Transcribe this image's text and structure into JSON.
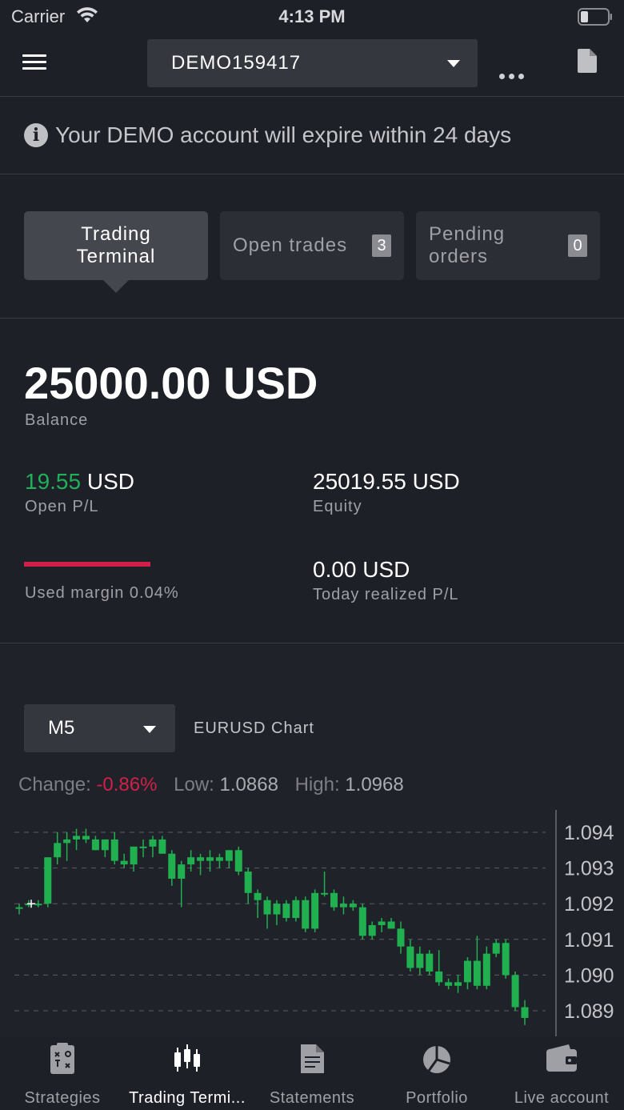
{
  "status_bar": {
    "carrier": "Carrier",
    "time": "4:13 PM"
  },
  "header": {
    "account": "DEMO159417",
    "more_icon": "ellipsis-icon",
    "doc_icon": "document-icon"
  },
  "notice": {
    "icon": "info-icon",
    "text": "Your DEMO account will expire within 24 days"
  },
  "tabs": [
    {
      "label": "Trading Terminal",
      "badge": null,
      "active": true
    },
    {
      "label": "Open trades",
      "badge": "3",
      "active": false
    },
    {
      "label": "Pending orders",
      "badge": "0",
      "active": false
    }
  ],
  "summary": {
    "balance": "25000.00 USD",
    "balance_label": "Balance",
    "open_pl_value": "19.55",
    "open_pl_unit": "USD",
    "open_pl_label": "Open P/L",
    "equity_value": "25019.55 USD",
    "equity_label": "Equity",
    "used_margin_label": "Used margin 0.04%",
    "used_margin_pct": 0.04,
    "today_value": "0.00 USD",
    "today_label": "Today realized P/L"
  },
  "chart_controls": {
    "timeframe": "M5",
    "title": "EURUSD Chart",
    "change_label": "Change:",
    "change_value": "-0.86%",
    "low_label": "Low:",
    "low_value": "1.0868",
    "high_label": "High:",
    "high_value": "1.0968"
  },
  "colors": {
    "up": "#20b050",
    "down": "#20b050",
    "negative": "#d0204a",
    "grid": "#5a5c62",
    "axis_text": "#c4c5c9"
  },
  "chart_data": {
    "type": "candlestick",
    "title": "EURUSD Chart",
    "y_ticks": [
      "1.094",
      "1.093",
      "1.092",
      "1.091",
      "1.090",
      "1.089"
    ],
    "ylim": [
      1.0883,
      1.0946
    ],
    "grid": true,
    "candles": [
      [
        1.0919,
        1.092,
        1.0917,
        1.0919
      ],
      [
        1.092,
        1.0921,
        1.0919,
        1.092
      ],
      [
        1.092,
        1.0921,
        1.0919,
        1.092
      ],
      [
        1.092,
        1.0933,
        1.0919,
        1.0933
      ],
      [
        1.0933,
        1.094,
        1.0931,
        1.0937
      ],
      [
        1.0937,
        1.094,
        1.0932,
        1.0938
      ],
      [
        1.0938,
        1.0941,
        1.0935,
        1.0939
      ],
      [
        1.0939,
        1.0941,
        1.0937,
        1.0938
      ],
      [
        1.0938,
        1.0939,
        1.0935,
        1.0935
      ],
      [
        1.0935,
        1.0938,
        1.0933,
        1.0938
      ],
      [
        1.0938,
        1.094,
        1.0931,
        1.0932
      ],
      [
        1.0932,
        1.0934,
        1.093,
        1.0931
      ],
      [
        1.0931,
        1.0936,
        1.0929,
        1.0936
      ],
      [
        1.0936,
        1.0938,
        1.0933,
        1.0936
      ],
      [
        1.0936,
        1.0939,
        1.0933,
        1.0938
      ],
      [
        1.0938,
        1.0939,
        1.0934,
        1.0934
      ],
      [
        1.0934,
        1.0935,
        1.0925,
        1.0927
      ],
      [
        1.0927,
        1.0932,
        1.0919,
        1.0931
      ],
      [
        1.0931,
        1.0935,
        1.0929,
        1.0933
      ],
      [
        1.0933,
        1.0934,
        1.0928,
        1.0932
      ],
      [
        1.0932,
        1.0935,
        1.0929,
        1.0933
      ],
      [
        1.0933,
        1.0934,
        1.093,
        1.0932
      ],
      [
        1.0932,
        1.0935,
        1.093,
        1.0935
      ],
      [
        1.0935,
        1.0936,
        1.0928,
        1.0929
      ],
      [
        1.0929,
        1.093,
        1.092,
        1.0923
      ],
      [
        1.0923,
        1.0924,
        1.0916,
        1.0921
      ],
      [
        1.0921,
        1.0922,
        1.0913,
        1.0917
      ],
      [
        1.0917,
        1.0921,
        1.0914,
        1.092
      ],
      [
        1.092,
        1.0921,
        1.0915,
        1.0916
      ],
      [
        1.0916,
        1.0922,
        1.0915,
        1.0921
      ],
      [
        1.0921,
        1.0922,
        1.0912,
        1.0913
      ],
      [
        1.0913,
        1.0924,
        1.0912,
        1.0923
      ],
      [
        1.0923,
        1.0929,
        1.0922,
        1.0923
      ],
      [
        1.0923,
        1.0924,
        1.0918,
        1.0919
      ],
      [
        1.0919,
        1.0922,
        1.0917,
        1.092
      ],
      [
        1.092,
        1.0921,
        1.0918,
        1.0919
      ],
      [
        1.0919,
        1.092,
        1.091,
        1.0911
      ],
      [
        1.0911,
        1.0915,
        1.091,
        1.0914
      ],
      [
        1.0914,
        1.0916,
        1.0912,
        1.0915
      ],
      [
        1.0915,
        1.0916,
        1.0913,
        1.0913
      ],
      [
        1.0913,
        1.0915,
        1.0906,
        1.0908
      ],
      [
        1.0908,
        1.091,
        1.0901,
        1.0902
      ],
      [
        1.0902,
        1.0908,
        1.09,
        1.0906
      ],
      [
        1.0906,
        1.0907,
        1.09,
        1.0901
      ],
      [
        1.0901,
        1.0907,
        1.0897,
        1.0898
      ],
      [
        1.0898,
        1.0899,
        1.0896,
        1.0897
      ],
      [
        1.0897,
        1.09,
        1.0895,
        1.0898
      ],
      [
        1.0898,
        1.0905,
        1.0896,
        1.0904
      ],
      [
        1.0904,
        1.0911,
        1.0896,
        1.0897
      ],
      [
        1.0897,
        1.0908,
        1.0896,
        1.0906
      ],
      [
        1.0906,
        1.091,
        1.0905,
        1.0909
      ],
      [
        1.0909,
        1.091,
        1.0899,
        1.09
      ],
      [
        1.09,
        1.0901,
        1.089,
        1.0891
      ],
      [
        1.0891,
        1.0893,
        1.0886,
        1.0888
      ]
    ]
  },
  "tabbar": [
    {
      "label": "Strategies",
      "icon": "strategy-board-icon",
      "active": false
    },
    {
      "label": "Trading Termi...",
      "icon": "candlestick-icon",
      "active": true
    },
    {
      "label": "Statements",
      "icon": "statement-icon",
      "active": false
    },
    {
      "label": "Portfolio",
      "icon": "pie-chart-icon",
      "active": false
    },
    {
      "label": "Live account",
      "icon": "wallet-icon",
      "active": false
    }
  ]
}
